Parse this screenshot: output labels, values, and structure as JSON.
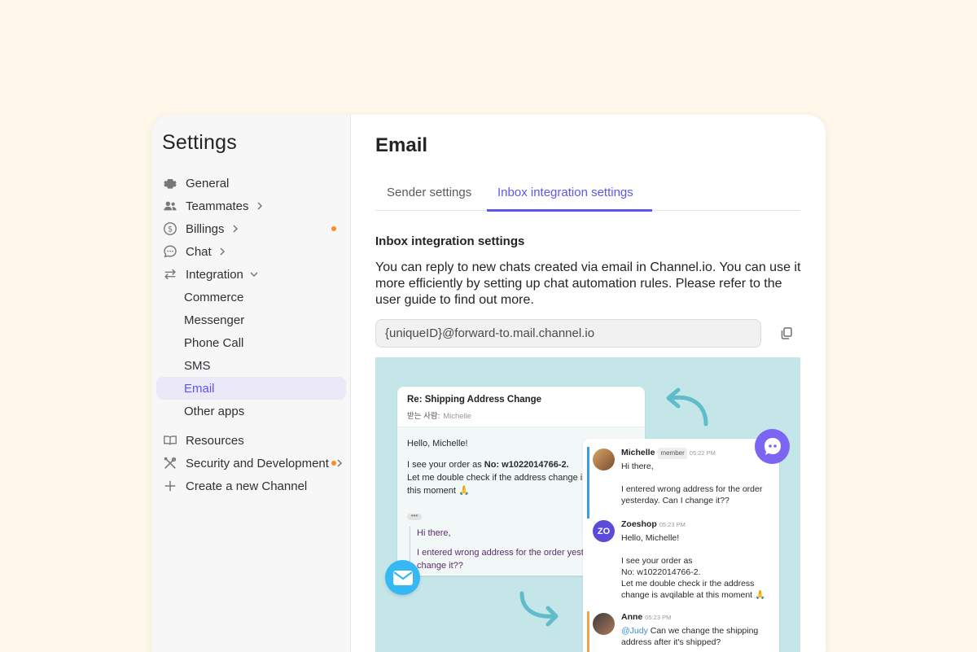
{
  "sidebar": {
    "title": "Settings",
    "items": [
      {
        "label": "General",
        "icon": "gear-icon"
      },
      {
        "label": "Teammates",
        "icon": "users-icon"
      },
      {
        "label": "Billings",
        "icon": "dollar-icon"
      },
      {
        "label": "Chat",
        "icon": "chat-bubble-icon"
      },
      {
        "label": "Integration",
        "icon": "arrows-swap-icon"
      },
      {
        "label": "Commerce"
      },
      {
        "label": "Messenger"
      },
      {
        "label": "Phone Call"
      },
      {
        "label": "SMS"
      },
      {
        "label": "Email",
        "active": true
      },
      {
        "label": "Other apps"
      },
      {
        "label": "Resources",
        "icon": "book-icon"
      },
      {
        "label": "Security and Development",
        "icon": "tools-icon"
      },
      {
        "label": "Create a new Channel",
        "icon": "plus-icon"
      }
    ],
    "notification_dot_color": "#ff8a1f",
    "active_color": "#5e56f0"
  },
  "main": {
    "title": "Email",
    "tabs": [
      {
        "label": "Sender settings",
        "active": false
      },
      {
        "label": "Inbox integration settings",
        "active": true
      }
    ],
    "section_title": "Inbox integration settings",
    "description": "You can reply to new chats created via email in Channel.io. You can use it more efficiently by setting up chat automation rules. Please refer to the user guide to find out more.",
    "forward_address": "{uniqueID}@forward-to.mail.channel.io"
  },
  "illustration": {
    "email": {
      "subject": "Re: Shipping Address Change",
      "to_label": "받는 사람:",
      "to_name": "Michelle",
      "greeting": "Hello, Michelle!",
      "line1_prefix": "I see your order as ",
      "order_no": "No: w1022014766-2.",
      "line2": "Let me double check if the address change is available at this moment 🙏",
      "quote_dots": "•••",
      "quote1": "Hi there,",
      "quote2": "I entered wrong address for the order yesterday. Can I change it??"
    },
    "chat": [
      {
        "name": "Michelle",
        "badge": "member",
        "time": "05:22 PM",
        "lines": [
          "Hi there,",
          "",
          "I entered wrong address for the order yesterday. Can I change it??"
        ],
        "bar_color": "#3a9be6"
      },
      {
        "name": "Zoeshop",
        "time": "05:23 PM",
        "avatar_text": "ZO",
        "lines": [
          "Hello, Michelle!",
          "",
          "I see your order as",
          "No: w1022014766-2.",
          "Let me double check ir the address change is avqilable at this moment 🙏"
        ]
      },
      {
        "name": "Anne",
        "time": "05:23 PM",
        "mention": "@Judy",
        "text_after_mention": " Can we change the shipping address after it's shipped?",
        "bar_color": "#f5a04a"
      }
    ]
  }
}
